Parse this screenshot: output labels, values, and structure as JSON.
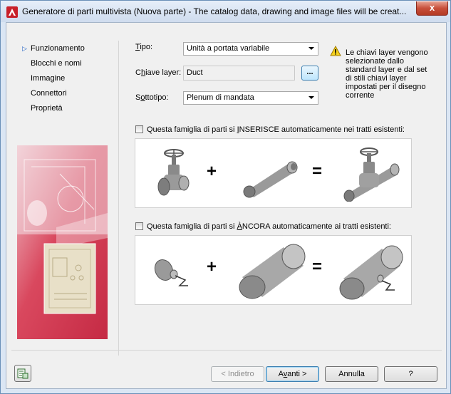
{
  "window": {
    "title": "Generatore di parti multivista (Nuova parte) - The catalog data, drawing and image files will be creat...",
    "close_glyph": "x"
  },
  "nav": {
    "items": [
      {
        "label": "Funzionamento",
        "active": true
      },
      {
        "label": "Blocchi e nomi",
        "active": false
      },
      {
        "label": "Immagine",
        "active": false
      },
      {
        "label": "Connettori",
        "active": false
      },
      {
        "label": "Proprietà",
        "active": false
      }
    ],
    "active_marker": "▷"
  },
  "form": {
    "tipo": {
      "label_u": "T",
      "label_rest": "ipo:",
      "value": "Unità a portata variabile"
    },
    "chiave_layer": {
      "label_pre": "C",
      "label_u": "h",
      "label_rest": "iave layer:",
      "value": "Duct",
      "browse_label": "..."
    },
    "sottotipo": {
      "label_pre": "S",
      "label_u": "o",
      "label_rest": "ttotipo:",
      "value": "Plenum di mandata"
    }
  },
  "warning": {
    "icon": "warning-triangle",
    "text": "Le chiavi layer vengono selezionate dallo standard layer e dal set di stili chiavi layer impostati per il disegno corrente"
  },
  "options": {
    "inserisce": {
      "checked": false,
      "label_pre": "Questa famiglia di parti si ",
      "label_u": "I",
      "label_rest": "NSERISCE automaticamente nei tratti esistenti:",
      "plus": "+",
      "equals": "="
    },
    "ancora": {
      "checked": false,
      "label_pre": "Questa famiglia di parti si ",
      "label_u": "À",
      "label_rest": "NCORA automaticamente ai tratti esistenti:",
      "plus": "+",
      "equals": "="
    }
  },
  "buttons": {
    "back": "< Indietro",
    "next_u": "v",
    "next_pre": "A",
    "next_rest": "anti >",
    "cancel": "Annulla",
    "help": "?"
  },
  "colors": {
    "accent": "#3c7fb1",
    "side_image_red": "#c8324a",
    "side_image_light": "#f0d8dc"
  }
}
